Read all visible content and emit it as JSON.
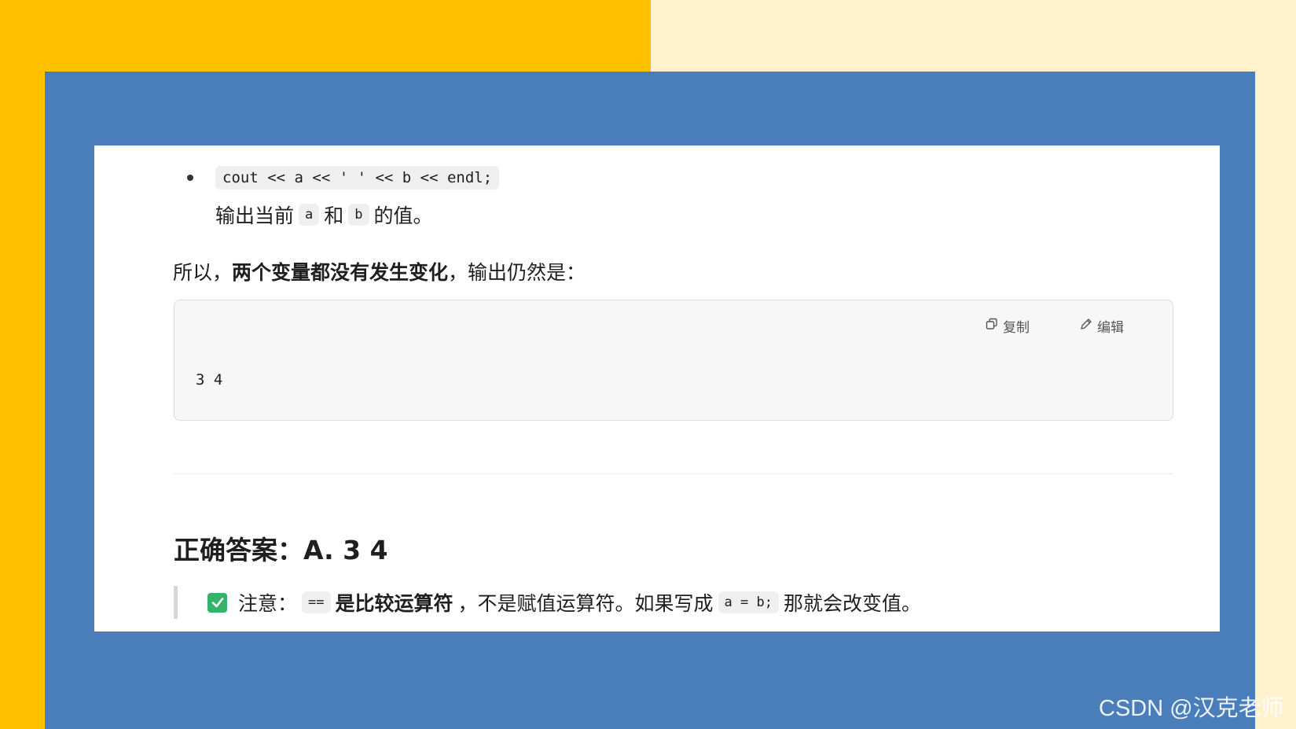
{
  "bullet": {
    "code": "cout << a << ' ' << b << endl;",
    "desc_prefix": "输出当前",
    "var_a": "a",
    "desc_mid": "和",
    "var_b": "b",
    "desc_suffix": "的值。"
  },
  "paragraph": {
    "prefix": "所以，",
    "bold": "两个变量都没有发生变化",
    "suffix": "，输出仍然是："
  },
  "codeblock": {
    "copy_label": "复制",
    "edit_label": "编辑",
    "content": "3 4"
  },
  "answer": {
    "text": "正确答案：A. 3 4"
  },
  "note": {
    "label": "注意：",
    "op": "==",
    "bold": "是比较运算符",
    "text1": "，不是赋值运算符。如果写成",
    "code": "a = b;",
    "text2": "那就会改变值。"
  },
  "watermark": "CSDN @汉克老师",
  "colors": {
    "yellow": "#ffc000",
    "cream": "#fff1cc",
    "blue": "#4a7ebb",
    "check_green": "#34b36a"
  }
}
